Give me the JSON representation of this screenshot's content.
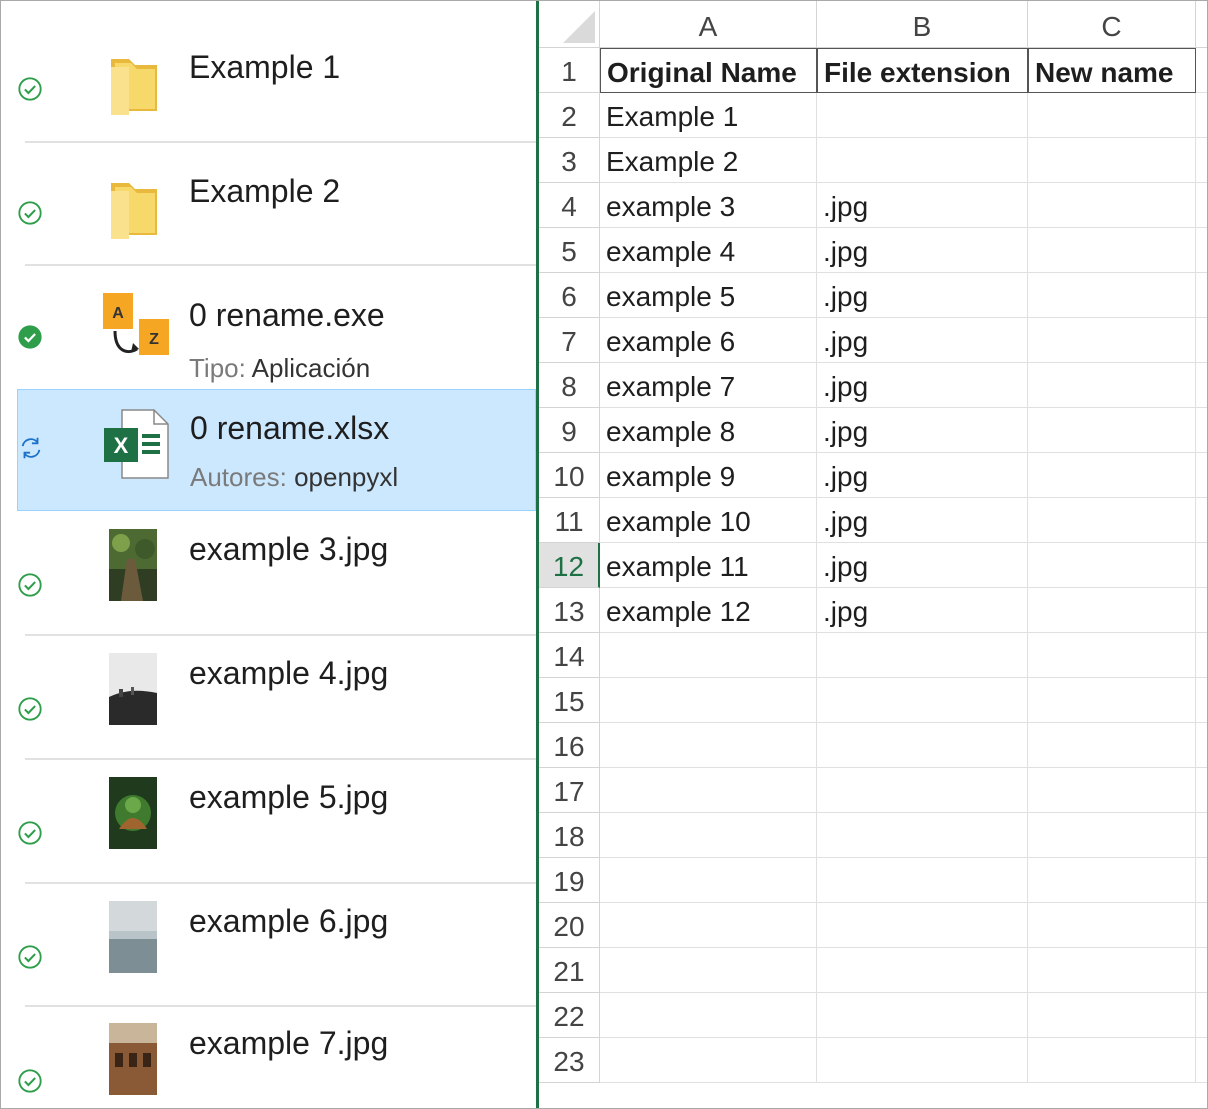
{
  "explorer": {
    "items": [
      {
        "name": "Example 1",
        "thumb": "folder-icon",
        "status": "synced"
      },
      {
        "name": "Example 2",
        "thumb": "folder-icon",
        "status": "synced"
      },
      {
        "name": "0 rename.exe",
        "thumb": "rename-app-icon",
        "status": "synced-filled",
        "meta_key": "Tipo:",
        "meta_val": "Aplicación"
      },
      {
        "name": "0 rename.xlsx",
        "thumb": "excel-file-icon",
        "status": "syncing",
        "meta_key": "Autores:",
        "meta_val": "openpyxl",
        "selected": true
      },
      {
        "name": "example 3.jpg",
        "thumb": "photo-forest-thumbnail",
        "status": "synced"
      },
      {
        "name": "example 4.jpg",
        "thumb": "photo-hill-thumbnail",
        "status": "synced"
      },
      {
        "name": "example 5.jpg",
        "thumb": "photo-mossy-arch-thumbnail",
        "status": "synced"
      },
      {
        "name": "example 6.jpg",
        "thumb": "photo-sea-sky-thumbnail",
        "status": "synced"
      },
      {
        "name": "example 7.jpg",
        "thumb": "photo-colosseum-thumbnail",
        "status": "synced"
      }
    ]
  },
  "sheet": {
    "columns": [
      "A",
      "B",
      "C"
    ],
    "row_numbers": [
      "1",
      "2",
      "3",
      "4",
      "5",
      "6",
      "7",
      "8",
      "9",
      "10",
      "11",
      "12",
      "13",
      "14",
      "15",
      "16",
      "17",
      "18",
      "19",
      "20",
      "21",
      "22",
      "23"
    ],
    "active_row": "12",
    "rows": [
      [
        "Original Name",
        "File extension",
        "New name"
      ],
      [
        "Example 1",
        "",
        ""
      ],
      [
        "Example 2",
        "",
        ""
      ],
      [
        "example 3",
        ".jpg",
        ""
      ],
      [
        "example 4",
        ".jpg",
        ""
      ],
      [
        "example 5",
        ".jpg",
        ""
      ],
      [
        "example 6",
        ".jpg",
        ""
      ],
      [
        "example 7",
        ".jpg",
        ""
      ],
      [
        "example 8",
        ".jpg",
        ""
      ],
      [
        "example 9",
        ".jpg",
        ""
      ],
      [
        "example 10",
        ".jpg",
        ""
      ],
      [
        "example 11",
        ".jpg",
        ""
      ],
      [
        "example 12",
        ".jpg",
        ""
      ]
    ]
  },
  "colors": {
    "sync_green": "#2e9e4a",
    "sync_blue": "#1e72c8",
    "selection_bg": "#cce8ff",
    "excel_green": "#1e7145",
    "folder_yellow": "#f6d86b"
  }
}
